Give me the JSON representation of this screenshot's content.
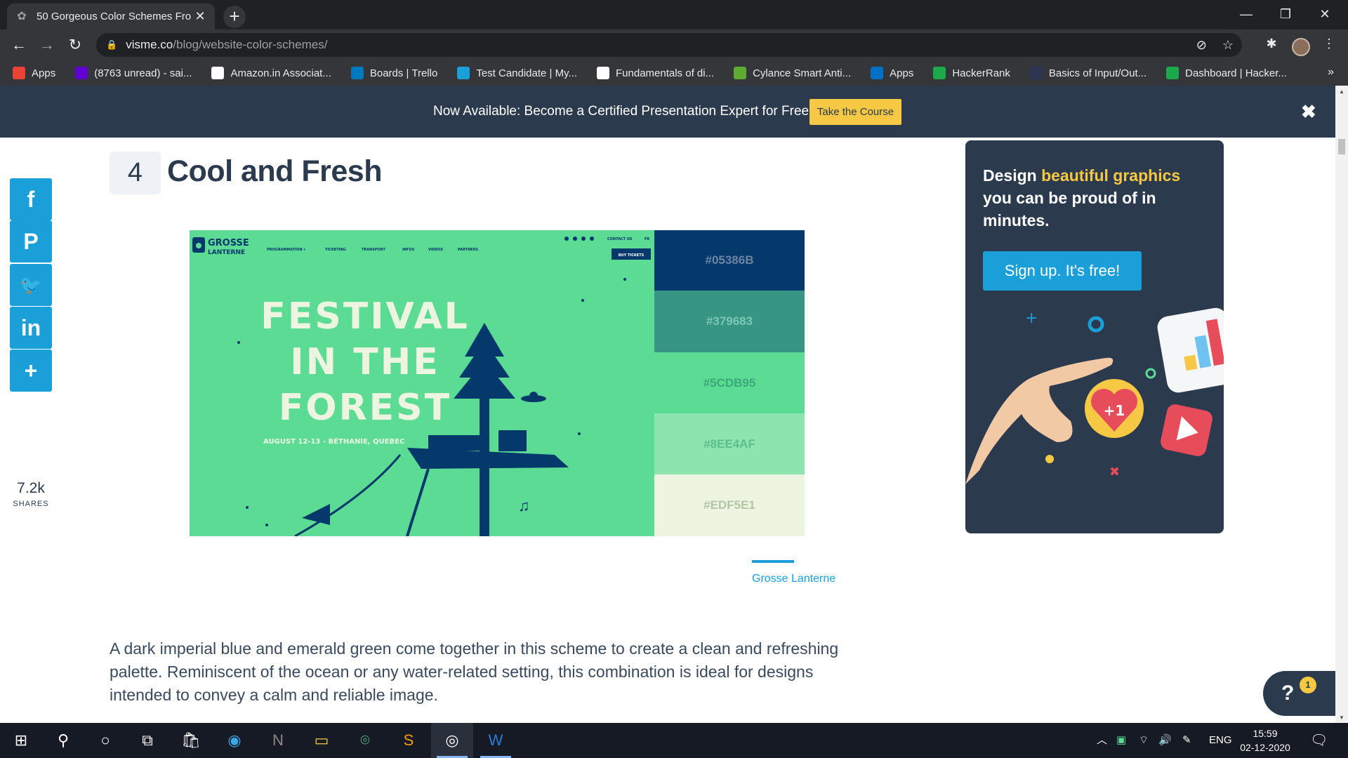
{
  "browser": {
    "tab_title": "50 Gorgeous Color Schemes Fro",
    "tab_close": "✕",
    "new_tab": "+",
    "url_host": "visme.co",
    "url_path": "/blog/website-color-schemes/",
    "window_controls": {
      "minimize": "—",
      "restore": "❐",
      "close": "✕"
    }
  },
  "bookmarks": [
    {
      "label": "Apps",
      "icon": "apps-grid-icon",
      "color": "#ea4335"
    },
    {
      "label": "(8763 unread) - sai...",
      "icon": "yahoo-icon",
      "color": "#5f01d1"
    },
    {
      "label": "Amazon.in Associat...",
      "icon": "amazon-icon",
      "color": "#ffffff"
    },
    {
      "label": "Boards | Trello",
      "icon": "trello-icon",
      "color": "#0079bf"
    },
    {
      "label": "Test Candidate | My...",
      "icon": "test-icon",
      "color": "#1a9fd9"
    },
    {
      "label": "Fundamentals of di...",
      "icon": "google-icon",
      "color": "#ffffff"
    },
    {
      "label": "Cylance Smart Anti...",
      "icon": "cylance-icon",
      "color": "#5dab2f"
    },
    {
      "label": "Apps",
      "icon": "intel-icon",
      "color": "#0071c5"
    },
    {
      "label": "HackerRank",
      "icon": "hackerrank-icon",
      "color": "#1ba94c"
    },
    {
      "label": "Basics of Input/Out...",
      "icon": "hackerearth-icon",
      "color": "#2c3454"
    },
    {
      "label": "Dashboard | Hacker...",
      "icon": "hackerrank-icon",
      "color": "#1ba94c"
    }
  ],
  "bookmarks_more": "»",
  "banner": {
    "text": "Now Available: Become a Certified Presentation Expert for Free",
    "cta": "Take the Course",
    "close": "✖"
  },
  "article": {
    "section_number": "4",
    "section_title": "Cool and Fresh",
    "image_caption": "Grosse Lanterne",
    "paragraph": "A dark imperial blue and emerald green come together in this scheme to create a clean and refreshing palette. Reminiscent of the ocean or any water-related setting, this combination is ideal for designs intended to convey a calm and reliable image."
  },
  "hero_site": {
    "logo_line1": "GROSSE",
    "logo_line2": "LANTERNE",
    "nav": [
      "PROGRAMMATION ▾",
      "TICKETING",
      "TRANSPORT",
      "INFOS",
      "VIDEOS",
      "PARTNERS"
    ],
    "contact": "CONTACT US",
    "lang": "FR",
    "buy": "BUY TICKETS",
    "headline": [
      "FESTIVAL",
      "IN THE",
      "FOREST"
    ],
    "dates": "AUGUST 12-13 - BÉTHANIE, QUEBEC"
  },
  "palette": [
    {
      "hex": "#05386B",
      "text_color": "#6b85a3"
    },
    {
      "hex": "#379683",
      "text_color": "#7cc6b6"
    },
    {
      "hex": "#5CDB95",
      "text_color": "#3ba877"
    },
    {
      "hex": "#8EE4AF",
      "text_color": "#5bbf88"
    },
    {
      "hex": "#EDF5E1",
      "text_color": "#b4c4a6"
    }
  ],
  "share": {
    "buttons": [
      {
        "glyph": "f",
        "name": "facebook-share-button"
      },
      {
        "glyph": "P",
        "name": "pinterest-share-button"
      },
      {
        "glyph": "🐦",
        "name": "twitter-share-button"
      },
      {
        "glyph": "in",
        "name": "linkedin-share-button"
      },
      {
        "glyph": "+",
        "name": "more-share-button"
      }
    ],
    "count": "7.2k",
    "label": "SHARES"
  },
  "ad": {
    "head_pre": "Design ",
    "head_highlight": "beautiful graphics",
    "head_post": " you can be proud of in minutes.",
    "cta": "Sign up. It's free!",
    "badge": "+1"
  },
  "help": {
    "glyph": "?",
    "badge": "1"
  },
  "taskbar": {
    "lang": "ENG",
    "time": "15:59",
    "date": "02-12-2020"
  }
}
